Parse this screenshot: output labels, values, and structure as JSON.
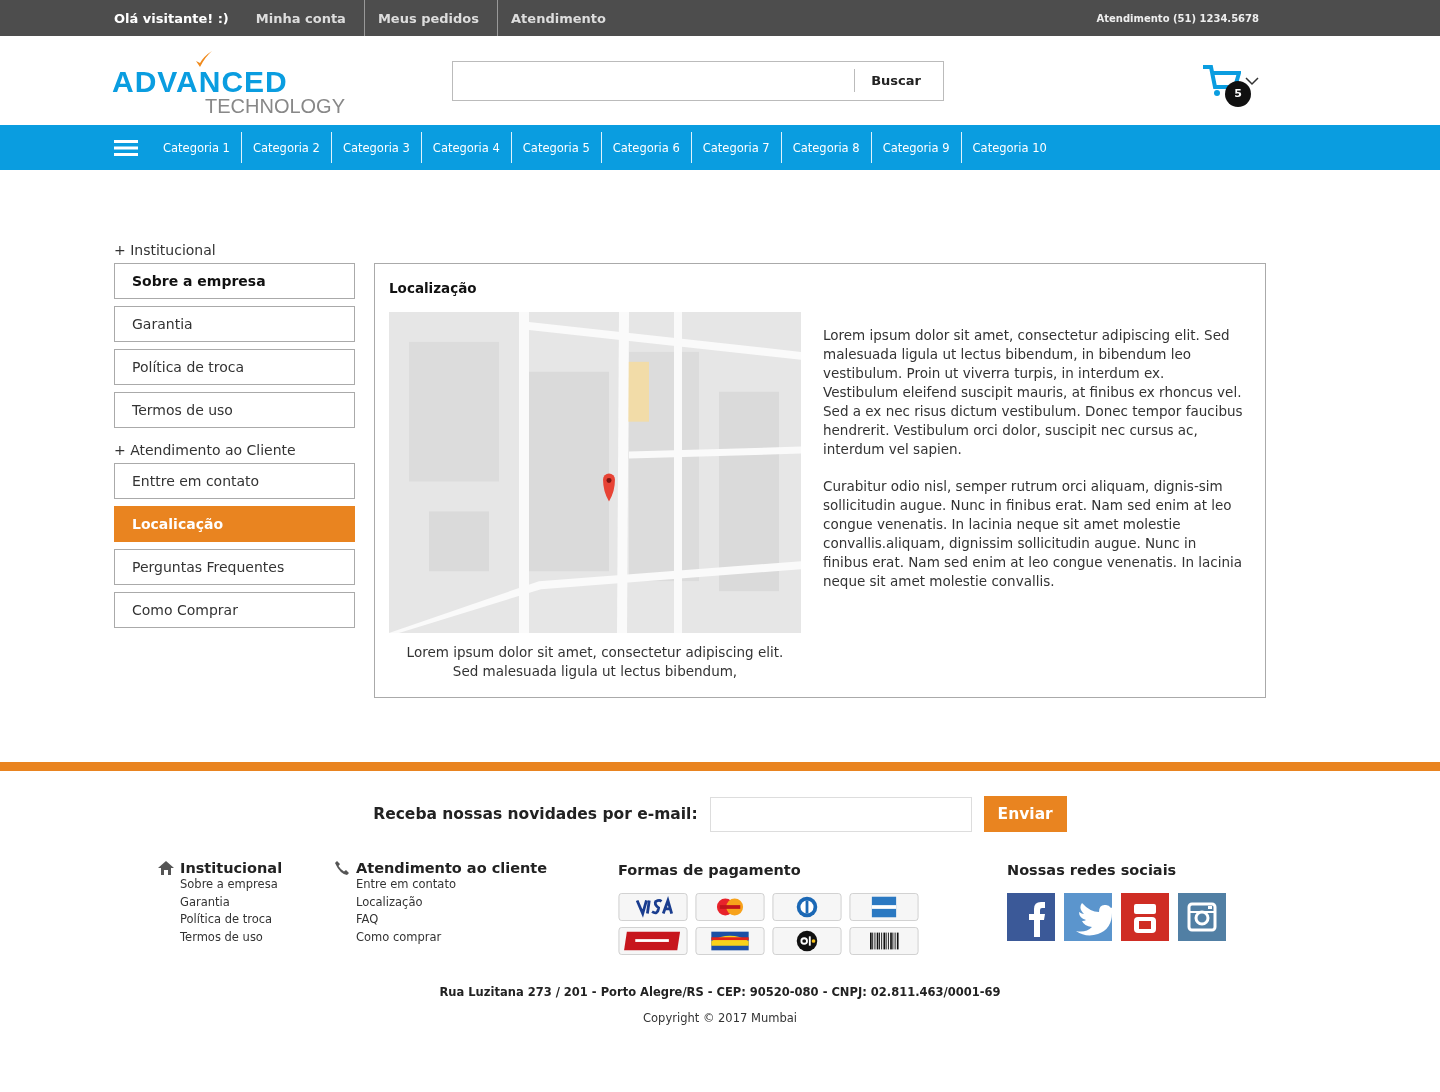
{
  "top_bar": {
    "greeting": "Olá visitante! :)",
    "links": [
      {
        "label": "Minha conta"
      },
      {
        "label": "Meus pedidos"
      },
      {
        "label": "Atendimento"
      }
    ],
    "phone": "Atendimento (51) 1234.5678"
  },
  "header": {
    "logo": {
      "primary": "ADVANCED",
      "secondary": "TECHNOLOGY"
    },
    "search": {
      "button": "Buscar"
    },
    "cart": {
      "count": "5"
    }
  },
  "categories": [
    "Categoria 1",
    "Categoria 2",
    "Categoria 3",
    "Categoria 4",
    "Categoria 5",
    "Categoria 6",
    "Categoria 7",
    "Categoria 8",
    "Categoria 9",
    "Categoria 10"
  ],
  "sidebar": {
    "groups": [
      {
        "title": "+ Institucional",
        "items": [
          {
            "label": "Sobre a empresa",
            "selected": false,
            "bold": true
          },
          {
            "label": "Garantia",
            "selected": false,
            "bold": false
          },
          {
            "label": "Política de troca",
            "selected": false,
            "bold": false
          },
          {
            "label": "Termos de uso",
            "selected": false,
            "bold": false
          }
        ]
      },
      {
        "title": "+ Atendimento ao Cliente",
        "items": [
          {
            "label": "Enttre em contato",
            "selected": false,
            "bold": false
          },
          {
            "label": "Localicação",
            "selected": true,
            "bold": false
          },
          {
            "label": "Perguntas Frequentes",
            "selected": false,
            "bold": false
          },
          {
            "label": "Como Comprar",
            "selected": false,
            "bold": false
          }
        ]
      }
    ]
  },
  "content": {
    "title": "Localização",
    "map": {
      "kind": "picture"
    },
    "caption": "Lorem ipsum dolor sit amet, consectetur adipiscing elit. Sed malesuada ligula ut lectus bibendum,",
    "paragraphs": [
      "Lorem ipsum dolor sit amet, consectetur adipiscing elit. Sed malesuada ligula ut lectus bibendum, in bibendum leo vestibulum. Proin ut viverra turpis, in interdum ex. Vestibulum eleifend suscipit mauris, at finibus ex rhoncus vel. Sed a ex nec risus dictum vestibulum. Donec tempor faucibus hendrerit. Vestibulum orci dolor, suscipit nec cursus ac, interdum vel sapien.",
      "Curabitur odio nisl, semper rutrum orci aliquam, dignis-sim sollicitudin augue. Nunc in finibus erat. Nam sed enim at leo congue venenatis. In lacinia neque sit amet molestie convallis.aliquam, dignissim sollicitudin augue. Nunc in finibus erat. Nam sed enim at leo congue venenatis. In lacinia neque sit amet molestie convallis."
    ]
  },
  "newsletter": {
    "label": "Receba nossas novidades por e-mail:",
    "button": "Enviar"
  },
  "footer": {
    "columns": [
      {
        "title": "Institucional",
        "kind": "home",
        "links": [
          "Sobre a empresa",
          "Garantia",
          "Política de troca",
          "Termos de uso"
        ]
      },
      {
        "title": "Atendimento ao cliente",
        "kind": "phone",
        "links": [
          "Entre em contato",
          "Localização",
          "FAQ",
          "Como comprar"
        ]
      }
    ],
    "payments": {
      "title": "Formas de pagamento",
      "methods": [
        {
          "kind": "visa"
        },
        {
          "kind": "mastercard"
        },
        {
          "kind": "diners"
        },
        {
          "kind": "amex"
        },
        {
          "kind": "hipercard"
        },
        {
          "kind": "aura"
        },
        {
          "kind": "elo"
        },
        {
          "kind": "boleto"
        }
      ]
    },
    "social": {
      "title": "Nossas redes sociais",
      "networks": [
        {
          "kind": "facebook"
        },
        {
          "kind": "twitter"
        },
        {
          "kind": "youtube"
        },
        {
          "kind": "instagram"
        }
      ]
    },
    "address": "Rua Luzitana 273 / 201 - Porto Alegre/RS - CEP: 90520-080 - CNPJ: 02.811.463/0001-69",
    "copyright": "Copyright © 2017 Mumbai"
  }
}
